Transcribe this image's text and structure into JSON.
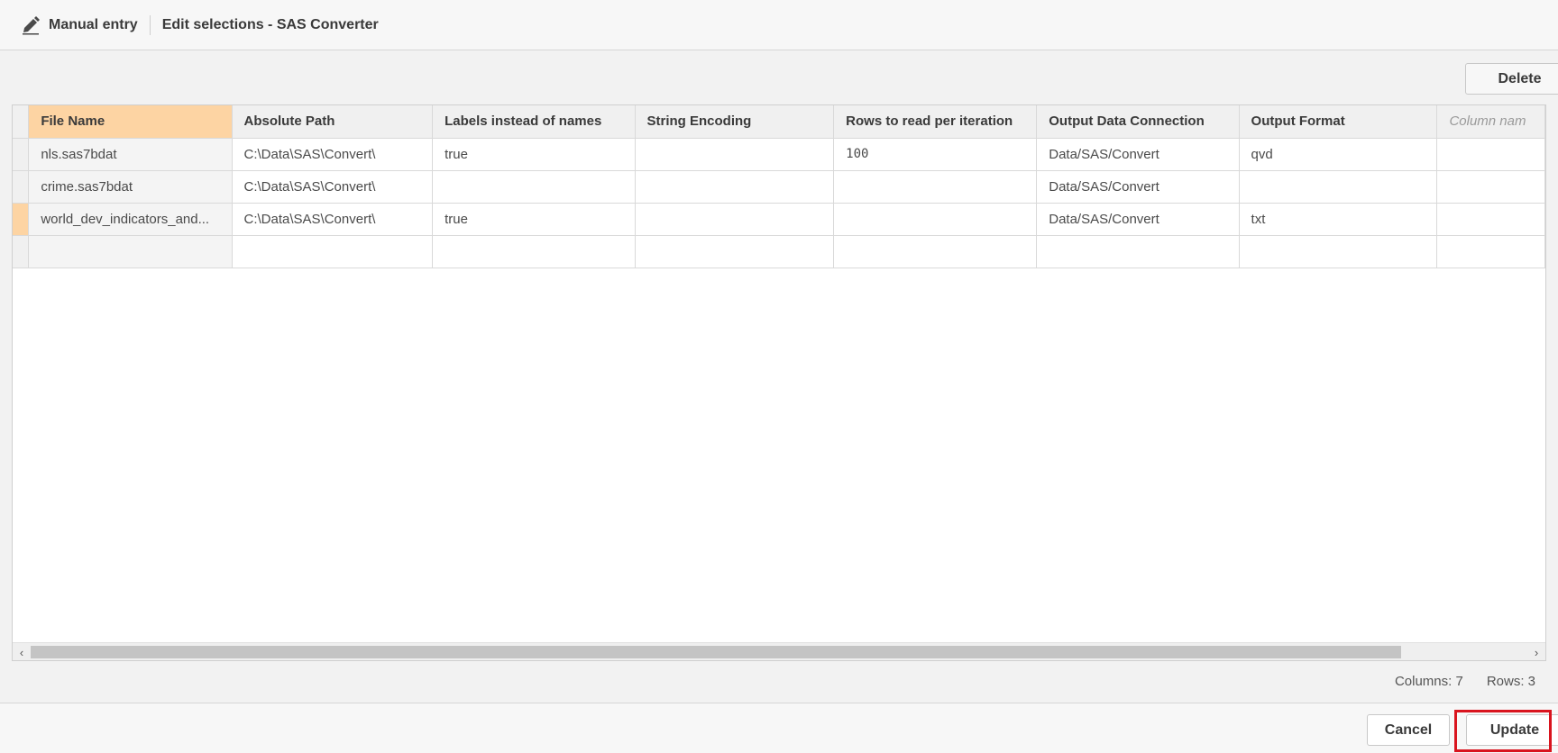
{
  "header": {
    "icon": "pencil-icon",
    "title": "Manual entry",
    "subtitle": "Edit selections - SAS Converter"
  },
  "toolbar": {
    "delete_label": "Delete"
  },
  "table": {
    "columns": [
      "File Name",
      "Absolute Path",
      "Labels instead of names",
      "String Encoding",
      "Rows to read per iteration",
      "Output Data Connection",
      "Output Format",
      "Column nam"
    ],
    "rows": [
      [
        "nls.sas7bdat",
        "C:\\Data\\SAS\\Convert\\",
        "true",
        "",
        "100",
        "Data/SAS/Convert",
        "qvd",
        ""
      ],
      [
        "crime.sas7bdat",
        "C:\\Data\\SAS\\Convert\\",
        "",
        "",
        "",
        "Data/SAS/Convert",
        "",
        ""
      ],
      [
        "world_dev_indicators_and...",
        "C:\\Data\\SAS\\Convert\\",
        "true",
        "",
        "",
        "Data/SAS/Convert",
        "txt",
        ""
      ],
      [
        "",
        "",
        "",
        "",
        "",
        "",
        "",
        ""
      ]
    ],
    "selected_row": 2,
    "selected_column": 0
  },
  "status": {
    "columns_text": "Columns: 7",
    "rows_text": "Rows: 3"
  },
  "footer": {
    "cancel_label": "Cancel",
    "update_label": "Update"
  },
  "colors": {
    "selection": "#fdd4a3",
    "highlight": "#d9141e"
  }
}
